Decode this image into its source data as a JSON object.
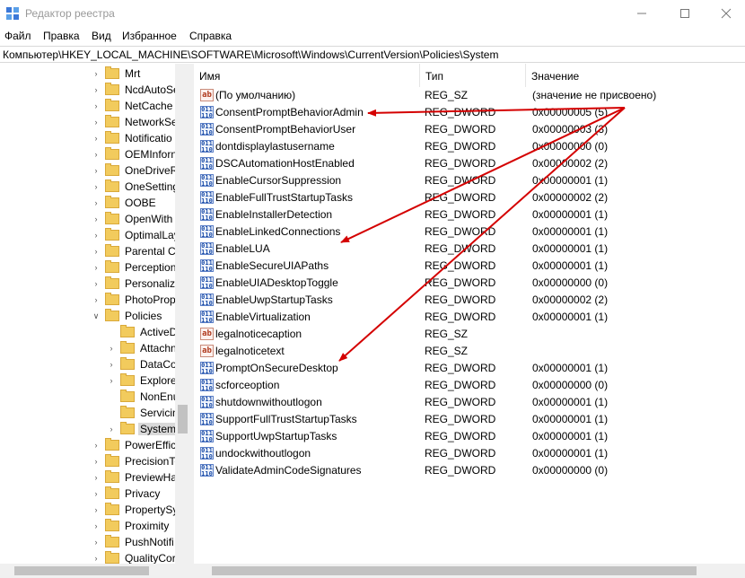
{
  "window": {
    "title": "Редактор реестра"
  },
  "menu": [
    {
      "label": "Файл"
    },
    {
      "label": "Правка"
    },
    {
      "label": "Вид"
    },
    {
      "label": "Избранное"
    },
    {
      "label": "Справка"
    }
  ],
  "address": "Компьютер\\HKEY_LOCAL_MACHINE\\SOFTWARE\\Microsoft\\Windows\\CurrentVersion\\Policies\\System",
  "tree": [
    {
      "label": "Mrt"
    },
    {
      "label": "NcdAutoSe"
    },
    {
      "label": "NetCache"
    },
    {
      "label": "NetworkSe"
    },
    {
      "label": "Notificatio"
    },
    {
      "label": "OEMInforn"
    },
    {
      "label": "OneDriveR"
    },
    {
      "label": "OneSetting"
    },
    {
      "label": "OOBE"
    },
    {
      "label": "OpenWith"
    },
    {
      "label": "OptimalLay"
    },
    {
      "label": "Parental Co"
    },
    {
      "label": "Perception"
    },
    {
      "label": "Personalize"
    },
    {
      "label": "PhotoProp"
    },
    {
      "label": "Policies"
    },
    {
      "label": "ActiveD"
    },
    {
      "label": "Attachn"
    },
    {
      "label": "DataCol"
    },
    {
      "label": "Explorer"
    },
    {
      "label": "NonEnu"
    },
    {
      "label": "Servicin"
    },
    {
      "label": "System"
    },
    {
      "label": "PowerEffic"
    },
    {
      "label": "PrecisionTo"
    },
    {
      "label": "PreviewHa"
    },
    {
      "label": "Privacy"
    },
    {
      "label": "PropertySy"
    },
    {
      "label": "Proximity"
    },
    {
      "label": "PushNotifi"
    },
    {
      "label": "QualityCor"
    }
  ],
  "columns": {
    "name": "Имя",
    "type": "Тип",
    "value": "Значение"
  },
  "values": [
    {
      "icon": "ab",
      "name": "(По умолчанию)",
      "type": "REG_SZ",
      "data": "(значение не присвоено)"
    },
    {
      "icon": "dword",
      "name": "ConsentPromptBehaviorAdmin",
      "type": "REG_DWORD",
      "data": "0x00000005 (5)"
    },
    {
      "icon": "dword",
      "name": "ConsentPromptBehaviorUser",
      "type": "REG_DWORD",
      "data": "0x00000003 (3)"
    },
    {
      "icon": "dword",
      "name": "dontdisplaylastusername",
      "type": "REG_DWORD",
      "data": "0x00000000 (0)"
    },
    {
      "icon": "dword",
      "name": "DSCAutomationHostEnabled",
      "type": "REG_DWORD",
      "data": "0x00000002 (2)"
    },
    {
      "icon": "dword",
      "name": "EnableCursorSuppression",
      "type": "REG_DWORD",
      "data": "0x00000001 (1)"
    },
    {
      "icon": "dword",
      "name": "EnableFullTrustStartupTasks",
      "type": "REG_DWORD",
      "data": "0x00000002 (2)"
    },
    {
      "icon": "dword",
      "name": "EnableInstallerDetection",
      "type": "REG_DWORD",
      "data": "0x00000001 (1)"
    },
    {
      "icon": "dword",
      "name": "EnableLinkedConnections",
      "type": "REG_DWORD",
      "data": "0x00000001 (1)"
    },
    {
      "icon": "dword",
      "name": "EnableLUA",
      "type": "REG_DWORD",
      "data": "0x00000001 (1)"
    },
    {
      "icon": "dword",
      "name": "EnableSecureUIAPaths",
      "type": "REG_DWORD",
      "data": "0x00000001 (1)"
    },
    {
      "icon": "dword",
      "name": "EnableUIADesktopToggle",
      "type": "REG_DWORD",
      "data": "0x00000000 (0)"
    },
    {
      "icon": "dword",
      "name": "EnableUwpStartupTasks",
      "type": "REG_DWORD",
      "data": "0x00000002 (2)"
    },
    {
      "icon": "dword",
      "name": "EnableVirtualization",
      "type": "REG_DWORD",
      "data": "0x00000001 (1)"
    },
    {
      "icon": "ab",
      "name": "legalnoticecaption",
      "type": "REG_SZ",
      "data": ""
    },
    {
      "icon": "ab",
      "name": "legalnoticetext",
      "type": "REG_SZ",
      "data": ""
    },
    {
      "icon": "dword",
      "name": "PromptOnSecureDesktop",
      "type": "REG_DWORD",
      "data": "0x00000001 (1)"
    },
    {
      "icon": "dword",
      "name": "scforceoption",
      "type": "REG_DWORD",
      "data": "0x00000000 (0)"
    },
    {
      "icon": "dword",
      "name": "shutdownwithoutlogon",
      "type": "REG_DWORD",
      "data": "0x00000001 (1)"
    },
    {
      "icon": "dword",
      "name": "SupportFullTrustStartupTasks",
      "type": "REG_DWORD",
      "data": "0x00000001 (1)"
    },
    {
      "icon": "dword",
      "name": "SupportUwpStartupTasks",
      "type": "REG_DWORD",
      "data": "0x00000001 (1)"
    },
    {
      "icon": "dword",
      "name": "undockwithoutlogon",
      "type": "REG_DWORD",
      "data": "0x00000001 (1)"
    },
    {
      "icon": "dword",
      "name": "ValidateAdminCodeSignatures",
      "type": "REG_DWORD",
      "data": "0x00000000 (0)"
    }
  ],
  "colors": {
    "annotation_arrow": "#d40000",
    "folder": "#f2cb5d",
    "selection": "#d9d9d9"
  }
}
